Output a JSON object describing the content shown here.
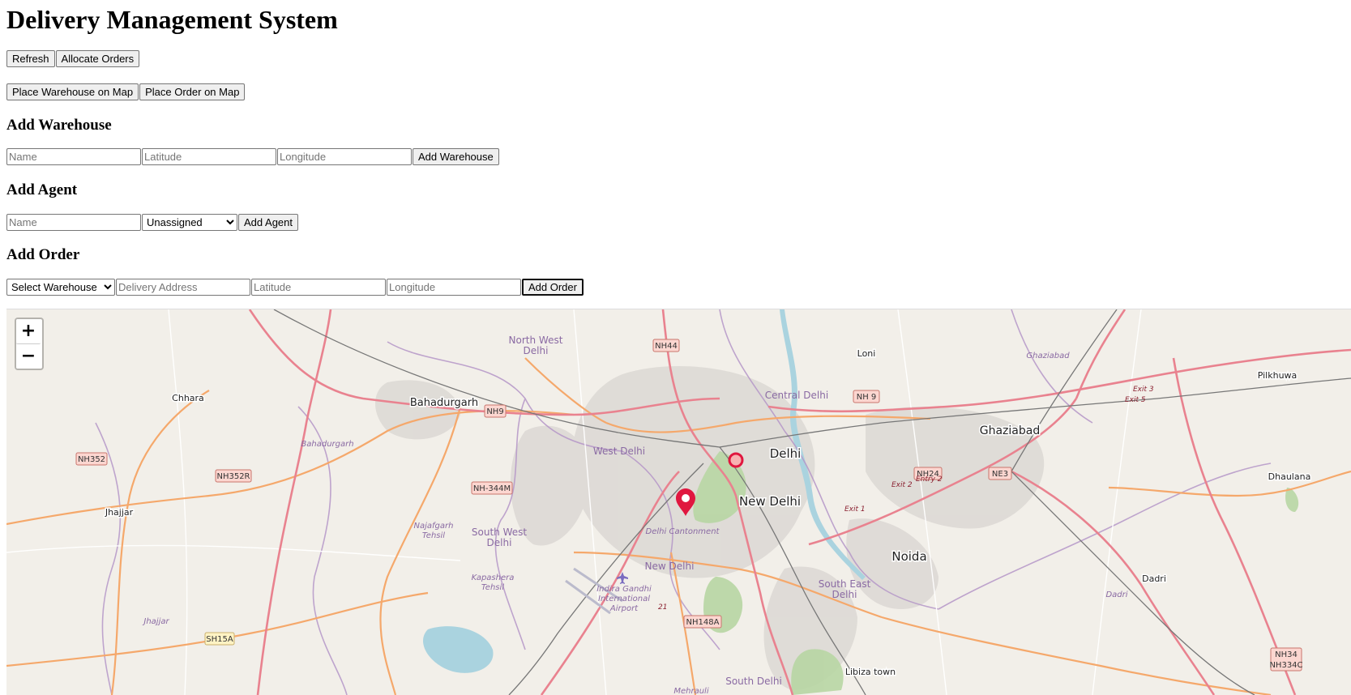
{
  "page": {
    "title": "Delivery Management System"
  },
  "toolbar": {
    "refresh_label": "Refresh",
    "allocate_label": "Allocate Orders",
    "place_warehouse_label": "Place Warehouse on Map",
    "place_order_label": "Place Order on Map"
  },
  "warehouse_form": {
    "heading": "Add Warehouse",
    "name_placeholder": "Name",
    "lat_placeholder": "Latitude",
    "lng_placeholder": "Longitude",
    "submit_label": "Add Warehouse"
  },
  "agent_form": {
    "heading": "Add Agent",
    "name_placeholder": "Name",
    "warehouse_selected": "Unassigned",
    "submit_label": "Add Agent"
  },
  "order_form": {
    "heading": "Add Order",
    "warehouse_selected": "Select Warehouse",
    "address_placeholder": "Delivery Address",
    "lat_placeholder": "Latitude",
    "lng_placeholder": "Longitude",
    "submit_label": "Add Order"
  },
  "map": {
    "zoom_in": "+",
    "zoom_out": "−",
    "colors": {
      "background": "#f2efe9",
      "primary_road": "#e9828f",
      "secondary_road": "#f5a86b",
      "marker": "#e0173f",
      "district": "#8a6aa3"
    },
    "places": {
      "delhi": "Delhi",
      "new_delhi": "New Delhi",
      "noida": "Noida",
      "ghaziabad": "Ghaziabad",
      "bahadurgarh": "Bahadurgarh",
      "jhajjar": "Jhajjar",
      "chhara": "Chhara",
      "loni": "Loni",
      "pilkhuwa": "Pilkhuwa",
      "dhaulana": "Dhaulana",
      "dadri": "Dadri",
      "libiza": "Libiza town",
      "central_delhi": "Central Delhi",
      "north_west_delhi_1": "North West",
      "north_west_delhi_2": "Delhi",
      "west_delhi": "West Delhi",
      "south_west_delhi_1": "South West",
      "south_west_delhi_2": "Delhi",
      "south_east_delhi_1": "South East",
      "south_east_delhi_2": "Delhi",
      "south_delhi": "South Delhi",
      "new_delhi_district": "New Delhi",
      "delhi_cantonment": "Delhi Cantonment",
      "bahadurgarh_tehsil": "Bahadurgarh",
      "jhajjar_tehsil": "Jhajjar",
      "najafgarh_1": "Najafgarh",
      "najafgarh_2": "Tehsil",
      "kapashera_1": "Kapashera",
      "kapashera_2": "Tehsil",
      "ghaziabad_district": "Ghaziabad",
      "dadri_district": "Dadri",
      "mehrauli": "Mehrauli",
      "airport_1": "Indira Gandhi",
      "airport_2": "International",
      "airport_3": "Airport"
    },
    "road_shields": {
      "nh44": "NH44",
      "nh9a": "NH9",
      "nh9b": "NH 9",
      "nh352": "NH352",
      "nh352r": "NH352R",
      "nh344m": "NH-344M",
      "nh24": "NH24",
      "ne3": "NE3",
      "nh148a": "NH148A",
      "sh15a": "SH15A",
      "nh34": "NH34",
      "nh334c": "NH334C"
    },
    "exits": {
      "exit1": "Exit 1",
      "exit2": "Exit 2",
      "entry2": "Entry 2",
      "exit3": "Exit 3",
      "exit5": "Exit 5",
      "n21": "21"
    }
  }
}
